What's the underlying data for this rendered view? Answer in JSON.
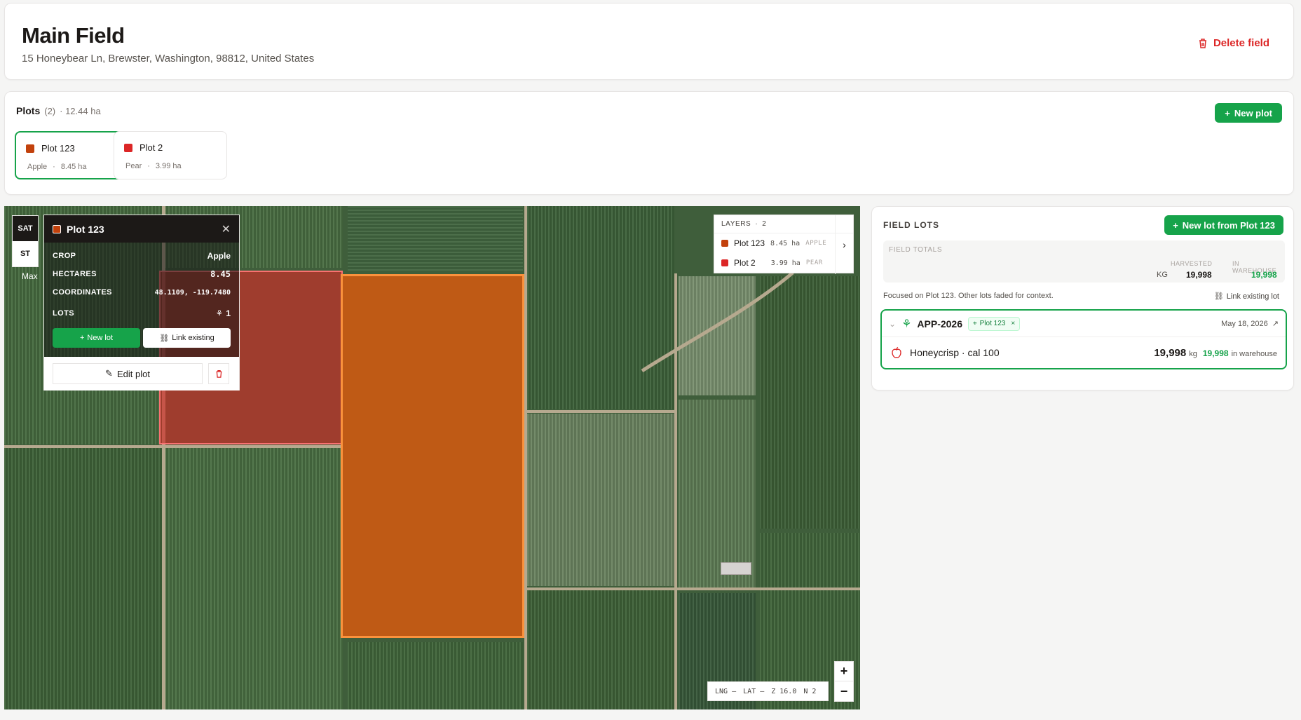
{
  "header": {
    "title": "Main Field",
    "address": "15 Honeybear Ln, Brewster, Washington, 98812, United States",
    "delete_label": "Delete field"
  },
  "plots": {
    "label": "Plots",
    "count": "(2)",
    "total": "· 12.44 ha",
    "new_plot_label": "New plot",
    "items": [
      {
        "name": "Plot 123",
        "crop": "Apple",
        "area": "8.45 ha",
        "color": "#c2410c"
      },
      {
        "name": "Plot 2",
        "crop": "Pear",
        "area": "3.99 ha",
        "color": "#dc2626"
      }
    ]
  },
  "map": {
    "modes": [
      "SAT",
      "ST"
    ],
    "max_label": "Max",
    "popup": {
      "title": "Plot 123",
      "crop_label": "CROP",
      "crop_value": "Apple",
      "hectares_label": "HECTARES",
      "hectares_value": "8.45",
      "coords_label": "COORDINATES",
      "coords_value": "48.1109, -119.7480",
      "lots_label": "LOTS",
      "lots_value": "1",
      "new_lot": "New lot",
      "link_existing": "Link existing",
      "edit_plot": "Edit plot"
    },
    "layers": {
      "label": "LAYERS",
      "count": "2",
      "items": [
        {
          "name": "Plot 123",
          "area": "8.45 ha",
          "crop": "APPLE",
          "color": "#c2410c"
        },
        {
          "name": "Plot 2",
          "area": "3.99 ha",
          "crop": "PEAR",
          "color": "#dc2626"
        }
      ]
    },
    "coords_bar": {
      "lng": "LNG –",
      "lat": "LAT –",
      "zoom": "Z 16.0",
      "n": "N 2"
    },
    "zoom_in": "+",
    "zoom_out": "−"
  },
  "lots": {
    "title": "FIELD LOTS",
    "new_lot_label": "New lot from Plot 123",
    "totals_label": "FIELD TOTALS",
    "harvested_label": "HARVESTED",
    "warehouse_label": "IN WAREHOUSE",
    "unit": "KG",
    "harvested_value": "19,998",
    "warehouse_value": "19,998",
    "focus_note": "Focused on Plot 123. Other lots faded for context.",
    "link_existing": "Link existing lot",
    "card": {
      "code": "APP-2026",
      "tag": "Plot 123",
      "date": "May 18, 2026",
      "variety": "Honeycrisp · cal 100",
      "qty": "19,998",
      "qty_unit": "kg",
      "warehouse_qty": "19,998",
      "warehouse_text": "in warehouse"
    }
  },
  "colors": {
    "accent": "#16a34a",
    "danger": "#dc2626",
    "plot123": "#c2410c",
    "plot2": "#dc2626"
  }
}
